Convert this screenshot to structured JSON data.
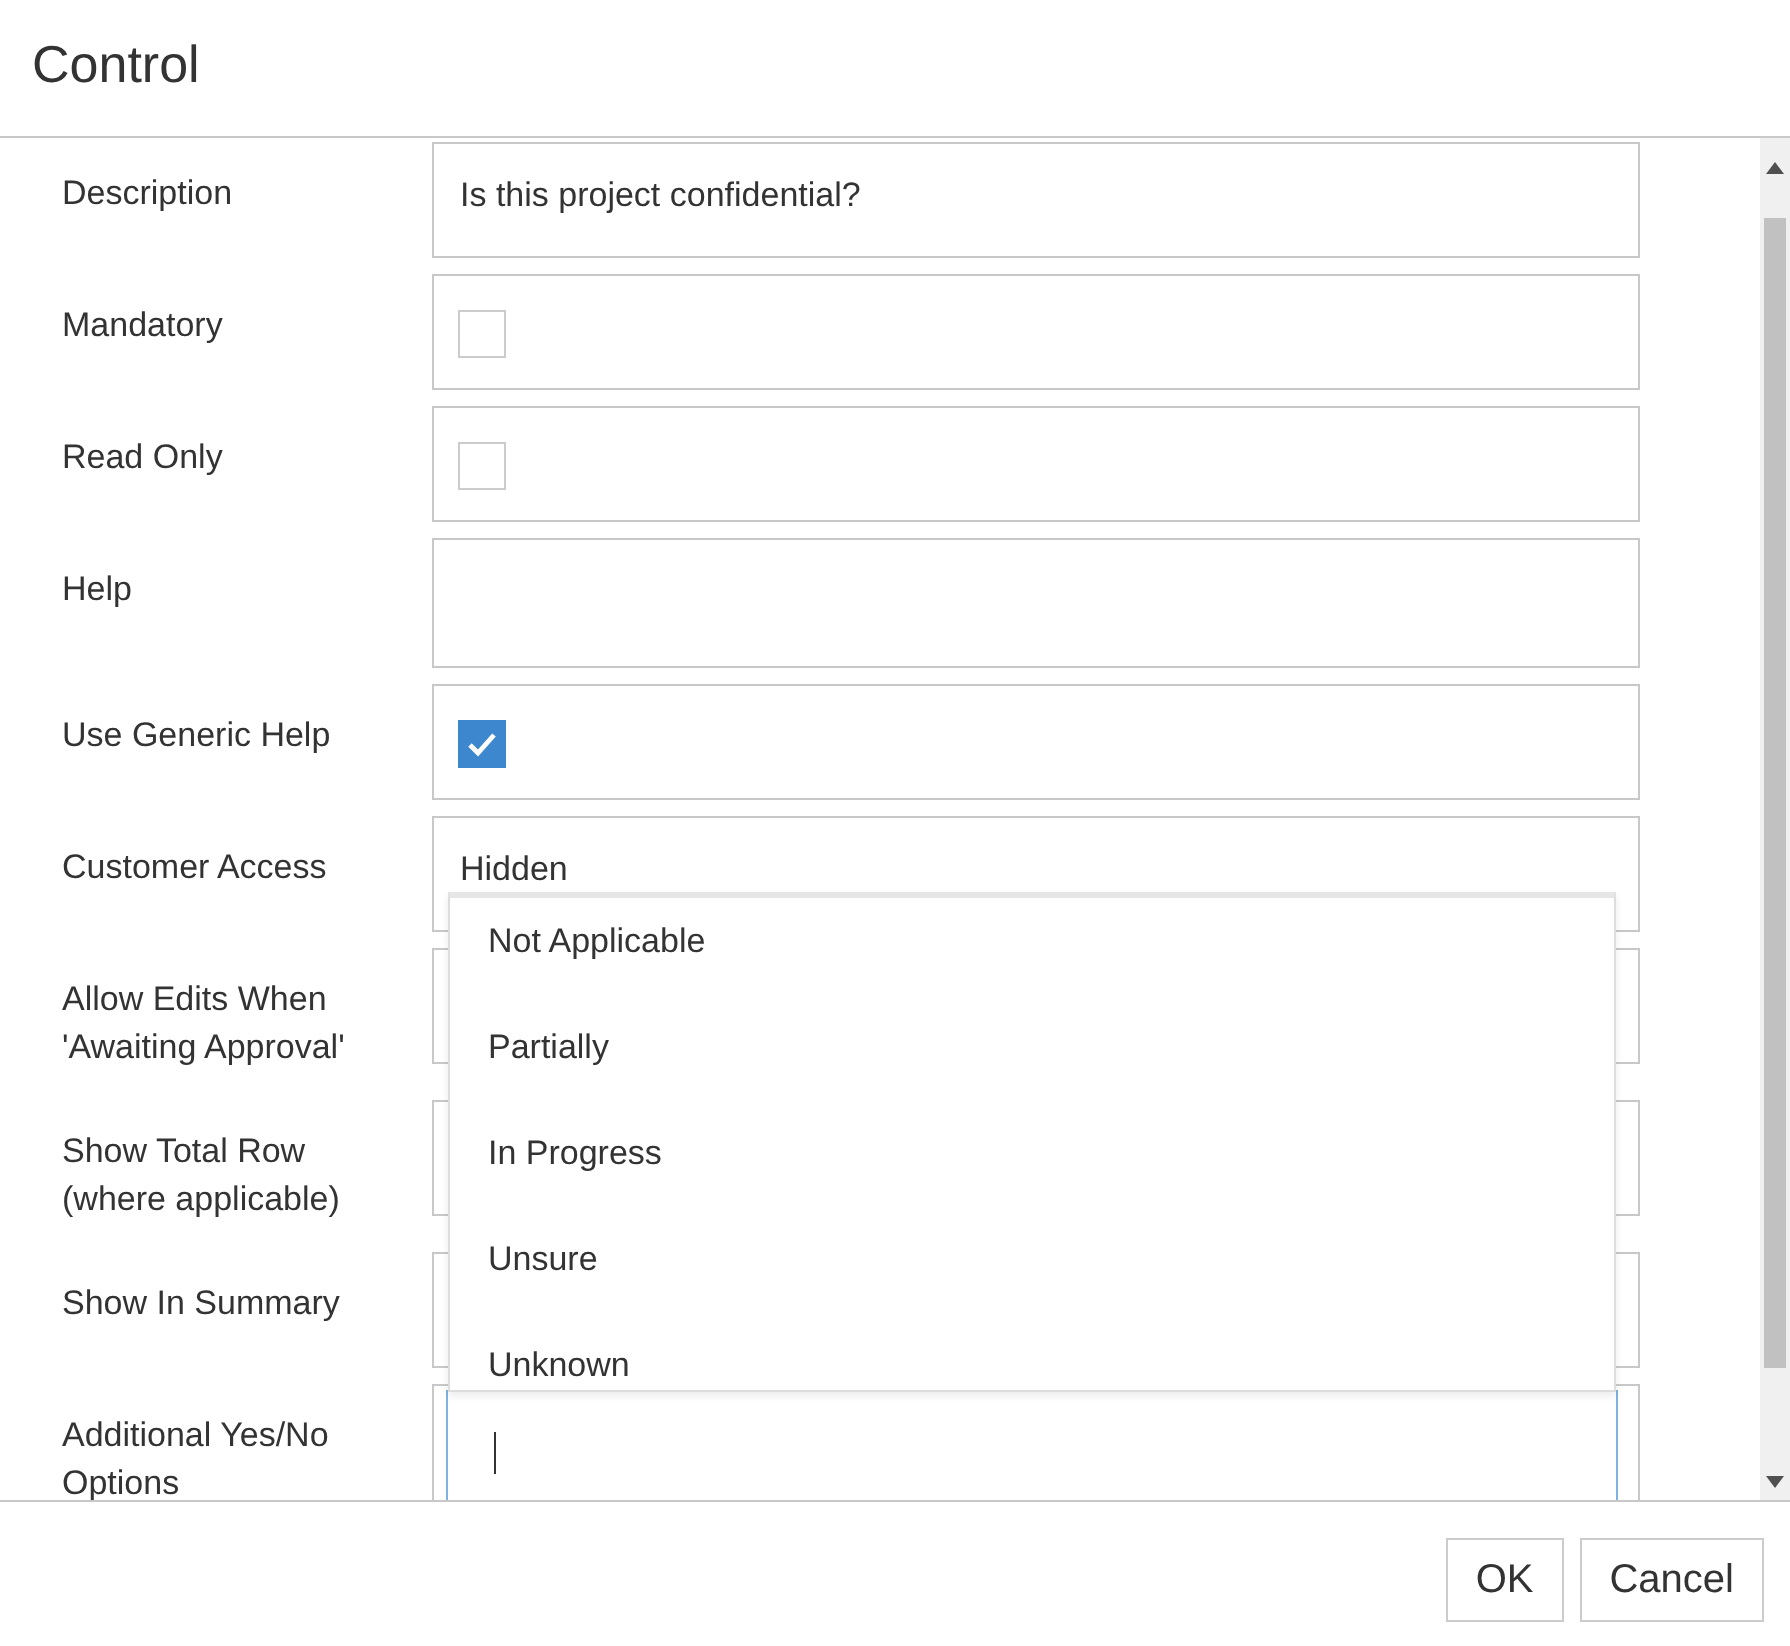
{
  "dialog": {
    "title": "Control"
  },
  "fields": [
    {
      "label": "Description",
      "kind": "text",
      "value": "Is this project confidential?"
    },
    {
      "label": "Mandatory",
      "kind": "checkbox",
      "checked": false
    },
    {
      "label": "Read Only",
      "kind": "checkbox",
      "checked": false
    },
    {
      "label": "Help",
      "kind": "textarea"
    },
    {
      "label": "Use Generic Help",
      "kind": "checkbox",
      "checked": true
    },
    {
      "label": "Customer Access",
      "kind": "select",
      "value": "Hidden",
      "expanded": true,
      "options": [
        "Not Applicable",
        "Partially",
        "In Progress",
        "Unsure",
        "Unknown"
      ]
    },
    {
      "label": "Allow Edits When 'Awaiting Approval'",
      "kind": "covered"
    },
    {
      "label": "Show Total Row (where applicable)",
      "kind": "covered"
    },
    {
      "label": "Show In Summary",
      "kind": "covered"
    },
    {
      "label": "Additional Yes/No Options",
      "kind": "combobox"
    }
  ],
  "buttons": [
    "OK",
    "Cancel"
  ]
}
